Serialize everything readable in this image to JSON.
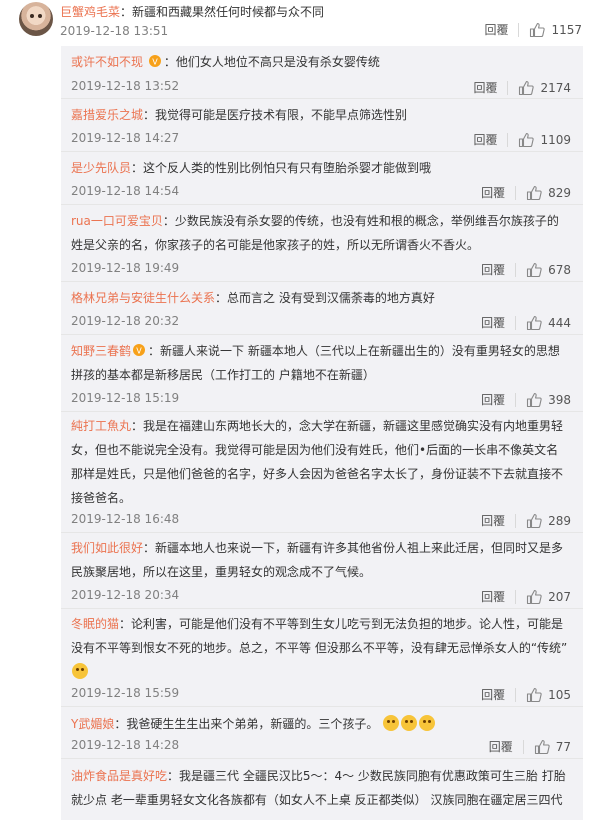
{
  "main_comment": {
    "username": "巨蟹鸡毛菜",
    "text": "新疆和西藏果然任何时候都与众不同",
    "time": "2019-12-18 13:51",
    "reply_label": "回覆",
    "likes": "1157"
  },
  "replies": [
    {
      "username": "或许不如不现",
      "text": "他们女人地位不高只是没有杀女婴传统",
      "time": "2019-12-18 13:52",
      "reply_label": "回覆",
      "likes": "2174"
    },
    {
      "username": "嘉措爱乐之城",
      "text": "我觉得可能是医疗技术有限，不能早点筛选性别",
      "time": "2019-12-18 14:27",
      "reply_label": "回覆",
      "likes": "1109"
    },
    {
      "username": "是少先队员",
      "text": "这个反人类的性别比例怕只有只有堕胎杀婴才能做到哦",
      "time": "2019-12-18 14:54",
      "reply_label": "回覆",
      "likes": "829"
    },
    {
      "username": "rua一口可爱宝贝",
      "text_lines": [
        "少数民族没有杀女婴的传统，也没有姓和根的概念，举例维吾尔族孩子的",
        "姓是父亲的名，你家孩子的名可能是他家孩子的姓，所以无所谓香火不香火。"
      ],
      "time": "2019-12-18 19:49",
      "reply_label": "回覆",
      "likes": "678"
    },
    {
      "username": "格林兄弟与安徒生什么关系",
      "text": "总而言之 没有受到汉儒荼毒的地方真好",
      "time": "2019-12-18 20:32",
      "reply_label": "回覆",
      "likes": "444"
    },
    {
      "username": "知野三春鹤",
      "text_lines": [
        "新疆人来说一下 新疆本地人（三代以上在新疆出生的）没有重男轻女的思想",
        "拼孩的基本都是新移居民（工作打工的 户籍地不在新疆）"
      ],
      "time": "2019-12-18 15:19",
      "reply_label": "回覆",
      "likes": "398"
    },
    {
      "username": "純打工魚丸",
      "text_lines": [
        "我是在福建山东两地长大的，念大学在新疆，新疆这里感觉确实没有内地重男轻",
        "女，但也不能说完全没有。我觉得可能是因为他们没有姓氏，他们•后面的一长串不像英文名",
        "那样是姓氏，只是他们爸爸的名字，好多人会因为爸爸名字太长了，身份证装不下去就直接不",
        "接爸爸名。"
      ],
      "time": "2019-12-18 16:48",
      "reply_label": "回覆",
      "likes": "289"
    },
    {
      "username": "我们如此很好",
      "text_lines": [
        "新疆本地人也来说一下，新疆有许多其他省份人祖上来此迁居，但同时又是多",
        "民族聚居地，所以在这里，重男轻女的观念成不了气候。"
      ],
      "time": "2019-12-18 20:34",
      "reply_label": "回覆",
      "likes": "207"
    },
    {
      "username": "冬眠的猫",
      "text_lines": [
        "论利害，可能是他们没有不平等到生女儿吃亏到无法负担的地步。论人性，可能是",
        "没有不平等到恨女不死的地步。总之，不平等 但没那么不平等，没有肆无忌惮杀女人的“传统”"
      ],
      "time": "2019-12-18 15:59",
      "reply_label": "回覆",
      "likes": "105"
    },
    {
      "username": "Y武媚娘",
      "text": "我爸硬生生生出来个弟弟，新疆的。三个孩子。",
      "time": "2019-12-18 14:28",
      "reply_label": "回覆",
      "likes": "77"
    },
    {
      "username": "油炸食品是真好吃",
      "text_lines": [
        "我是疆三代 全疆民汉比5～：4～ 少数民族同胞有优惠政策可生三胎 打胎",
        "就少点 老一辈重男轻女文化各族都有（如女人不上桌 反正都类似） 汉族同胞在疆定居三四代"
      ]
    }
  ],
  "icons": {
    "like": "thumbs-up-icon",
    "emoji": "smiley-face-icon",
    "badge": "fan-badge-icon"
  },
  "colors": {
    "username": "#eb7350",
    "reply_bg": "#f2f2f5",
    "time": "#808080"
  }
}
